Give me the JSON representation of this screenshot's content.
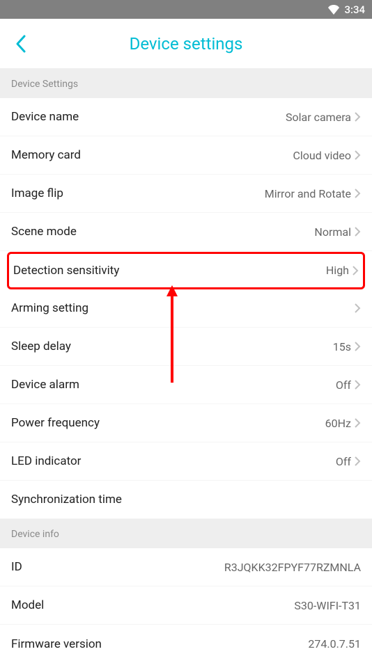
{
  "status": {
    "time": "3:34"
  },
  "nav": {
    "title": "Device settings"
  },
  "sections": {
    "settings_header": "Device Settings",
    "info_header": "Device info"
  },
  "rows": {
    "device_name": {
      "label": "Device name",
      "value": "Solar camera"
    },
    "memory_card": {
      "label": "Memory card",
      "value": "Cloud video"
    },
    "image_flip": {
      "label": "Image flip",
      "value": "Mirror and Rotate"
    },
    "scene_mode": {
      "label": "Scene mode",
      "value": "Normal"
    },
    "detection_sensitivity": {
      "label": "Detection sensitivity",
      "value": "High"
    },
    "arming_setting": {
      "label": "Arming setting",
      "value": ""
    },
    "sleep_delay": {
      "label": "Sleep delay",
      "value": "15s"
    },
    "device_alarm": {
      "label": "Device alarm",
      "value": "Off"
    },
    "power_frequency": {
      "label": "Power frequency",
      "value": "60Hz"
    },
    "led_indicator": {
      "label": "LED indicator",
      "value": "Off"
    },
    "sync_time": {
      "label": "Synchronization time",
      "value": ""
    },
    "id": {
      "label": "ID",
      "value": "R3JQKK32FPYF77RZMNLA"
    },
    "model": {
      "label": "Model",
      "value": "S30-WIFI-T31"
    },
    "firmware": {
      "label": "Firmware version",
      "value": "274.0.7.51"
    }
  }
}
